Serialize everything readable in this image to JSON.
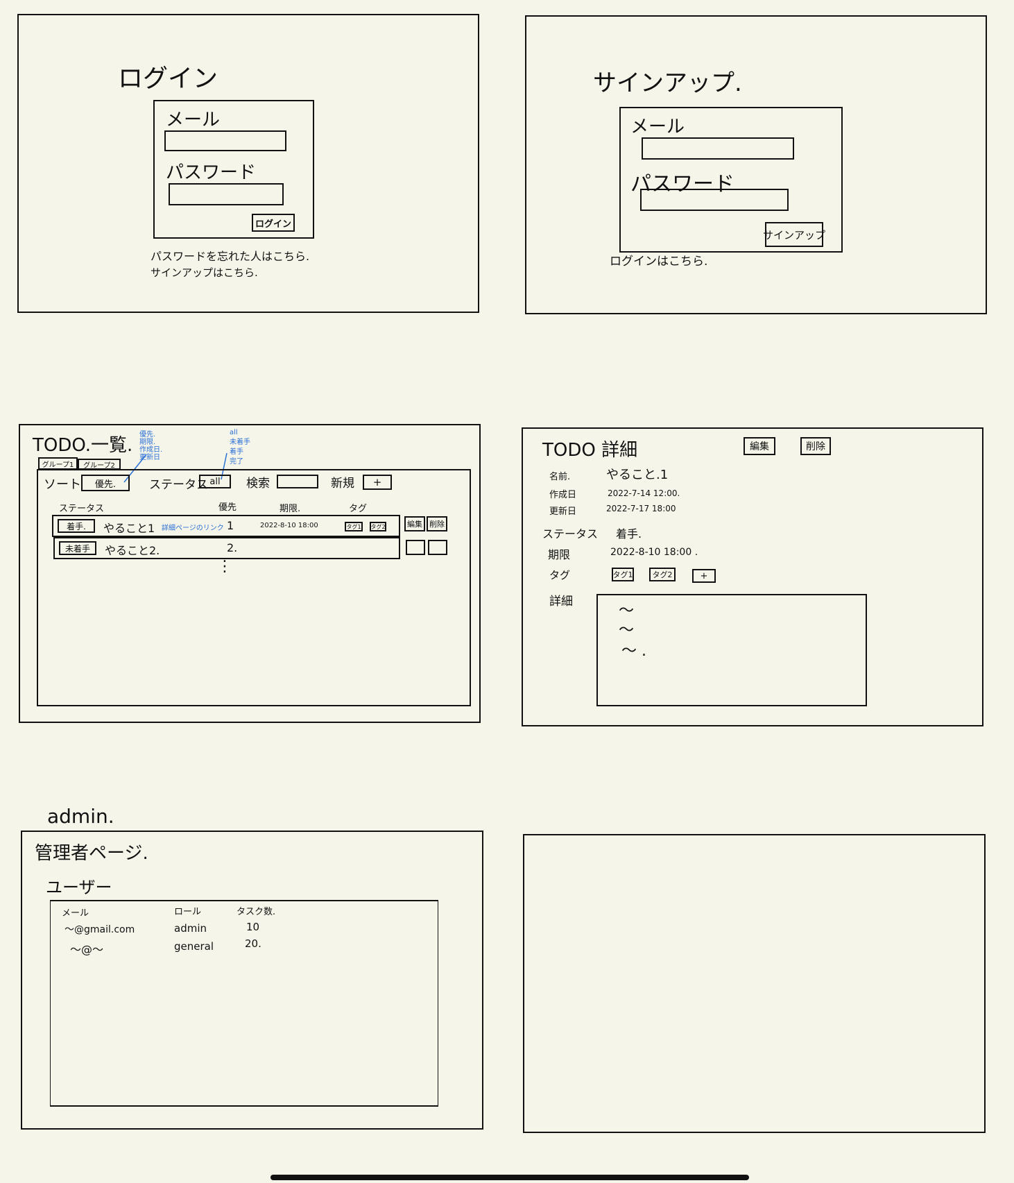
{
  "login": {
    "title": "ログイン",
    "mail_label": "メール",
    "password_label": "パスワード",
    "button": "ログイン",
    "forgot_link": "パスワードを忘れた人はこちら.",
    "signup_link": "サインアップはこちら."
  },
  "signup": {
    "title": "サインアップ.",
    "mail_label": "メール",
    "password_label": "パスワード",
    "button": "サインアップ",
    "login_link": "ログインはこちら."
  },
  "todo_list": {
    "title": "TODO.一覧.",
    "sort_options": [
      "優先.",
      "期限.",
      "作成日.",
      "更新日"
    ],
    "status_options": [
      "all",
      "未着手",
      "着手",
      "完了"
    ],
    "tabs": [
      "グループ1",
      "グループ2"
    ],
    "sort_label": "ソート",
    "sort_value": "優先.",
    "status_label": "ステータス",
    "status_value": "all",
    "search_label": "検索",
    "new_label": "新規",
    "new_button": "+",
    "columns": [
      "ステータス",
      "優先",
      "期限.",
      "タグ"
    ],
    "rows": [
      {
        "status": "着手.",
        "name": "やること1",
        "priority": "1",
        "deadline": "2022-8-10 18:00",
        "tags": [
          "タグ1",
          "タグ2"
        ]
      },
      {
        "status": "未着手",
        "name": "やること2.",
        "priority": "2.",
        "deadline": "",
        "tags": []
      }
    ],
    "detail_link_note": "詳細ページのリンク",
    "edit_button": "編集",
    "delete_button": "削除",
    "ellipsis": "⋮"
  },
  "todo_detail": {
    "title": "TODO 詳細",
    "edit_button": "編集",
    "delete_button": "削除",
    "name_label": "名前.",
    "name_value": "やること.1",
    "created_label": "作成日",
    "created_value": "2022-7-14 12:00.",
    "updated_label": "更新日",
    "updated_value": "2022-7-17 18:00",
    "status_label": "ステータス",
    "status_value": "着手.",
    "deadline_label": "期限",
    "deadline_value": "2022-8-10 18:00 .",
    "tags_label": "タグ",
    "tags": [
      "タグ1",
      "タグ2"
    ],
    "add_tag_button": "+",
    "detail_label": "詳細",
    "detail_lines": [
      "〜",
      "〜",
      "〜 ."
    ]
  },
  "admin": {
    "caption": "admin.",
    "title": "管理者ページ.",
    "users_heading": "ユーザー",
    "columns": [
      "メール",
      "ロール",
      "タスク数."
    ],
    "rows": [
      {
        "mail": "〜@gmail.com",
        "role": "admin",
        "tasks": "10"
      },
      {
        "mail": "〜@〜",
        "role": "general",
        "tasks": "20."
      }
    ]
  }
}
